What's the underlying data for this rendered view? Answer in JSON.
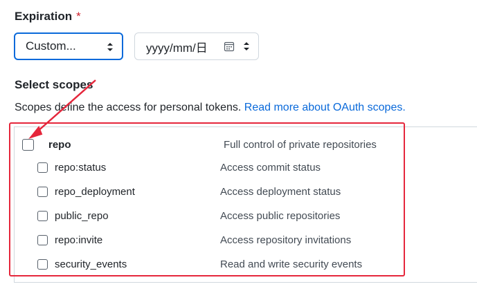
{
  "expiration": {
    "label": "Expiration",
    "required_mark": "*",
    "select_value": "Custom...",
    "date_placeholder": "yyyy/mm/日"
  },
  "scopes": {
    "title": "Select scopes",
    "description": "Scopes define the access for personal tokens.",
    "link_text": "Read more about OAuth scopes.",
    "parent": {
      "name": "repo",
      "description": "Full control of private repositories",
      "checked": false
    },
    "children": [
      {
        "name": "repo:status",
        "description": "Access commit status",
        "checked": false
      },
      {
        "name": "repo_deployment",
        "description": "Access deployment status",
        "checked": false
      },
      {
        "name": "public_repo",
        "description": "Access public repositories",
        "checked": false
      },
      {
        "name": "repo:invite",
        "description": "Access repository invitations",
        "checked": false
      },
      {
        "name": "security_events",
        "description": "Read and write security events",
        "checked": false
      }
    ]
  },
  "colors": {
    "accent": "#0969da",
    "highlight": "#e5263b",
    "required": "#cf222e"
  }
}
